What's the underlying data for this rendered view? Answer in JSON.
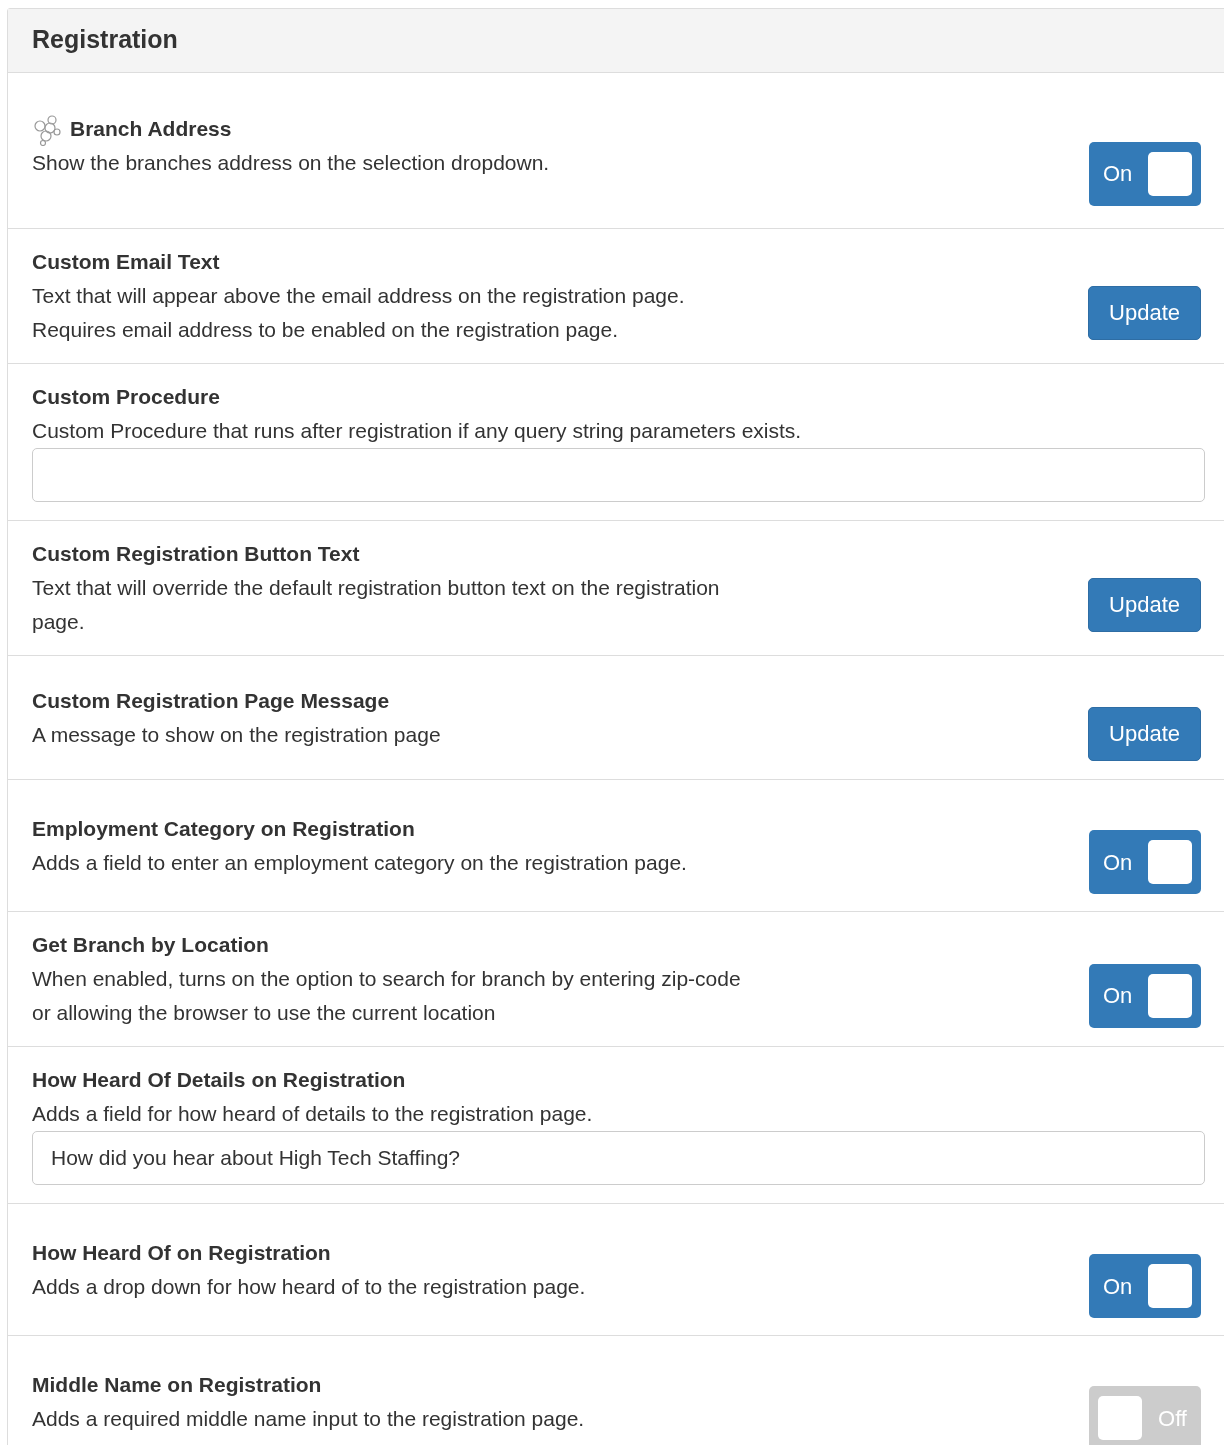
{
  "panel": {
    "title": "Registration"
  },
  "settings": [
    {
      "kind": "toggle",
      "title": "Branch Address",
      "icon": true,
      "description": "Show the branches address on the selection dropdown.",
      "on": true,
      "label": "On"
    },
    {
      "kind": "button",
      "title": "Custom Email Text",
      "description": "Text that will appear above the email address on the registration page. Requires email address to be enabled on the registration page.",
      "label": "Update"
    },
    {
      "kind": "input",
      "title": "Custom Procedure",
      "description": "Custom Procedure that runs after registration if any query string parameters exists."
    },
    {
      "kind": "button",
      "title": "Custom Registration Button Text",
      "description": "Text that will override the default registration button text on the registration page.",
      "label": "Update"
    },
    {
      "kind": "button",
      "title": "Custom Registration Page Message",
      "description": "A message to show on the registration page",
      "label": "Update"
    },
    {
      "kind": "toggle",
      "title": "Employment Category on Registration",
      "description": "Adds a field to enter an employment category on the registration page.",
      "on": true,
      "label": "On"
    },
    {
      "kind": "toggle",
      "title": "Get Branch by Location",
      "description": "When enabled, turns on the option to search for branch by entering zip-code or allowing the browser to use the current location",
      "on": true,
      "label": "On"
    },
    {
      "kind": "input",
      "title": "How Heard Of Details on Registration",
      "description": "Adds a field for how heard of details to the registration page.",
      "value": "How did you hear about High Tech Staffing?"
    },
    {
      "kind": "toggle",
      "title": "How Heard Of on Registration",
      "description": "Adds a drop down for how heard of to the registration page.",
      "on": true,
      "label": "On"
    },
    {
      "kind": "toggle",
      "title": "Middle Name on Registration",
      "description": "Adds a required middle name input to the registration page.",
      "on": false,
      "label": "Off"
    }
  ]
}
